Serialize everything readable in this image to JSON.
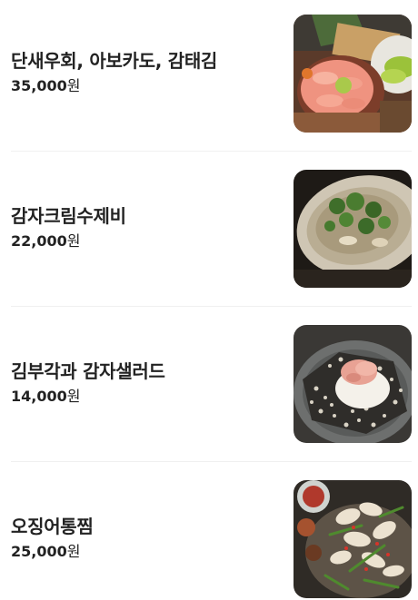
{
  "menu": {
    "items": [
      {
        "name": "단새우회, 아보카도, 감태김",
        "price_number": "35,000",
        "price_unit": "원",
        "photo_icon": "raw-shrimp-avocado-dish-photo"
      },
      {
        "name": "감자크림수제비",
        "price_number": "22,000",
        "price_unit": "원",
        "photo_icon": "potato-cream-sujebi-photo"
      },
      {
        "name": "김부각과 감자샐러드",
        "price_number": "14,000",
        "price_unit": "원",
        "photo_icon": "seaweed-chips-potato-salad-photo"
      },
      {
        "name": "오징어통찜",
        "price_number": "25,000",
        "price_unit": "원",
        "photo_icon": "steamed-squid-photo"
      }
    ]
  }
}
